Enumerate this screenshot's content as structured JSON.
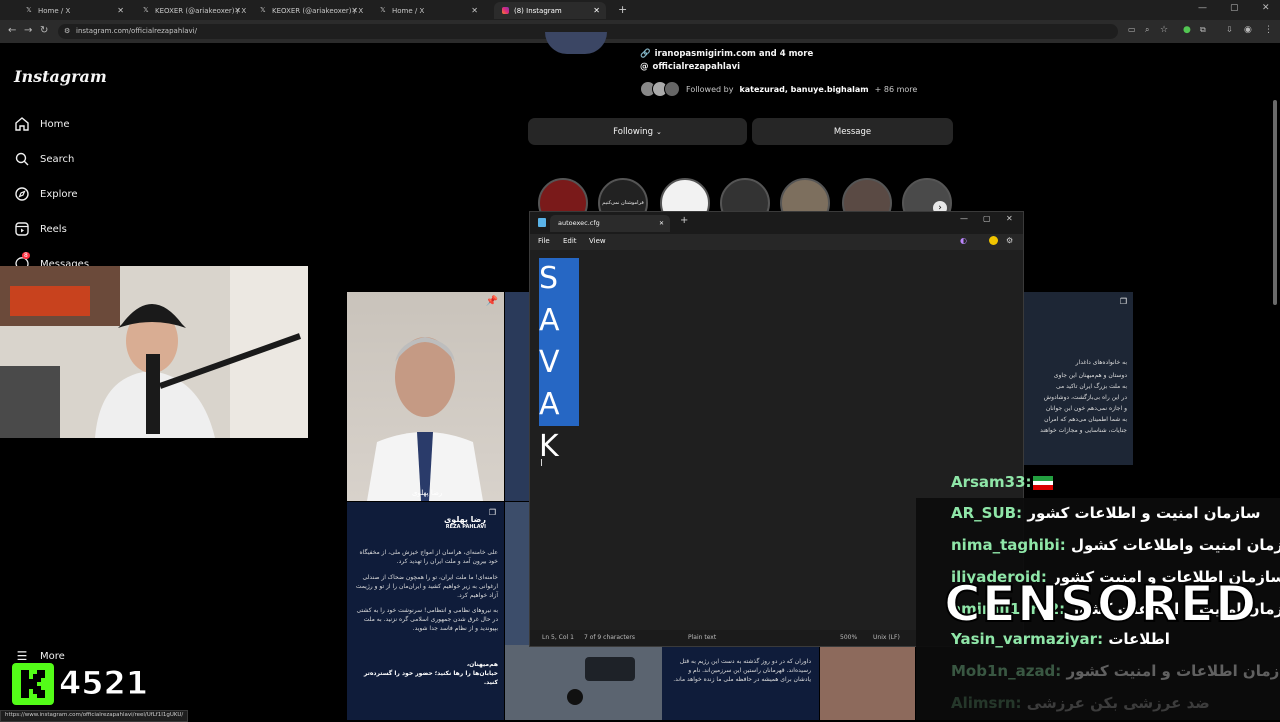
{
  "browser": {
    "tabs": [
      {
        "label": "Home / X",
        "icon": "x-logo-icon"
      },
      {
        "label": "KEOXER (@ariakeoxer) / X",
        "icon": "x-logo-icon"
      },
      {
        "label": "KEOXER (@ariakeoxer) / X",
        "icon": "x-logo-icon"
      },
      {
        "label": "Home / X",
        "icon": "x-logo-icon"
      },
      {
        "label": "(8) Instagram",
        "icon": "instagram-icon"
      }
    ],
    "url": "instagram.com/officialrezapahlavi/",
    "status_url": "https://www.instagram.com/officialrezapahlavi/reel/UfLf1I1gUKU/"
  },
  "instagram": {
    "logo": "Instagram",
    "nav": [
      {
        "label": "Home",
        "icon": "home-icon"
      },
      {
        "label": "Search",
        "icon": "search-icon"
      },
      {
        "label": "Explore",
        "icon": "compass-icon"
      },
      {
        "label": "Reels",
        "icon": "reels-icon"
      },
      {
        "label": "Messages",
        "icon": "messenger-icon",
        "badge": "8"
      }
    ],
    "more": "More",
    "profile": {
      "link": "iranopasmigirim.com and 4 more",
      "threads": "officialrezapahlavi",
      "followed_by_prefix": "Followed by",
      "followed_by_users": "katezurad, banuye.bighalam",
      "followed_by_more": "+ 86 more",
      "following_btn": "Following",
      "message_btn": "Message"
    },
    "story_label": "فراموشتان نمی‌کنیم",
    "post_name_fa": "رضا پهلوی",
    "post_name_en": "REZA PAHLAVI",
    "post_text": [
      "علی خامنه‌ای، هراسان از امواج خیزش ملی، از مخفیگاه خود بیرون آمد و ملت ایران را تهدید کرد.",
      "خامنه‌ای! ما ملت ایران، تو را همچون ضحاک از صندلی ارغوانی به زیر خواهیم کشید و ایران‌مان را از تو و رژیمت آزاد خواهیم کرد.",
      "به نیروهای نظامی و انتظامی! سرنوشت خود را به کشتی در حال غرق شدن جمهوری اسلامی گره نزنید. به ملت بپیوندید و از نظام فاسد جدا شوید.",
      "هم‌میهنان،",
      "خیابان‌ها را رها نکنید؛ حضور خود را گسترده‌تر کنید."
    ],
    "right_post_text": [
      "به خانواده‌های داغدار",
      "دوستان و هم‌میهنان این جاوی",
      "به ملت بزرگ ایران تاکید می",
      "در این راه بی‌بازگشت، دوشادوش",
      "و اجازه نمی‌دهم خون این جوانان",
      "به شما اطمینان می‌دهم که امران",
      "جنایات، شناسایی و مجازات خواهند"
    ],
    "bottom_post_text": "داوران که در دو روز گذشته به دست این رژیم به قتل رسیده‌اند. قهرمانان راستین این سرزمین‌اند. نام و یادشان برای همیشه در حافظه ملی ما زنده خواهد ماند."
  },
  "notepad": {
    "tab_title": "autoexec.cfg",
    "menu": [
      "File",
      "Edit",
      "View"
    ],
    "lines": [
      "S",
      "A",
      "V",
      "A",
      "K"
    ],
    "status": {
      "position": "Ln 5, Col 1",
      "chars": "7 of 9 characters",
      "format": "Plain text",
      "zoom": "500%",
      "eol": "Unix (LF)"
    }
  },
  "chat": [
    {
      "user": "Arsam33:",
      "message": "",
      "flag": "iran-flag-icon"
    },
    {
      "user": "AR_SUB:",
      "message": "سازمان امنیت و اطلاعات کشور"
    },
    {
      "user": "nima_taghibi:",
      "message": "سازمان امنیت واطلاعات کشول"
    },
    {
      "user": "iliyaderoid:",
      "message": "سازمان اطلاعات و امنیت کشور"
    },
    {
      "user": "amirali14rd2:",
      "message": "سازمان امنیت و اطلاعات کشور"
    },
    {
      "user": "Yasin_varmaziyar:",
      "message": "اطلاعات"
    },
    {
      "user": "Mob1n_azad:",
      "message": "سازمان اطلاعات و امنیت کشور"
    },
    {
      "user": "Alimsrn:",
      "message": "ضد عرزشی بکن عرزشی"
    }
  ],
  "censored": "CENSORED",
  "viewer_count": "4521",
  "colors": {
    "kick_green": "#53fc18",
    "chat_username": "#8fe6a8",
    "notepad_selection": "#2667c4"
  }
}
